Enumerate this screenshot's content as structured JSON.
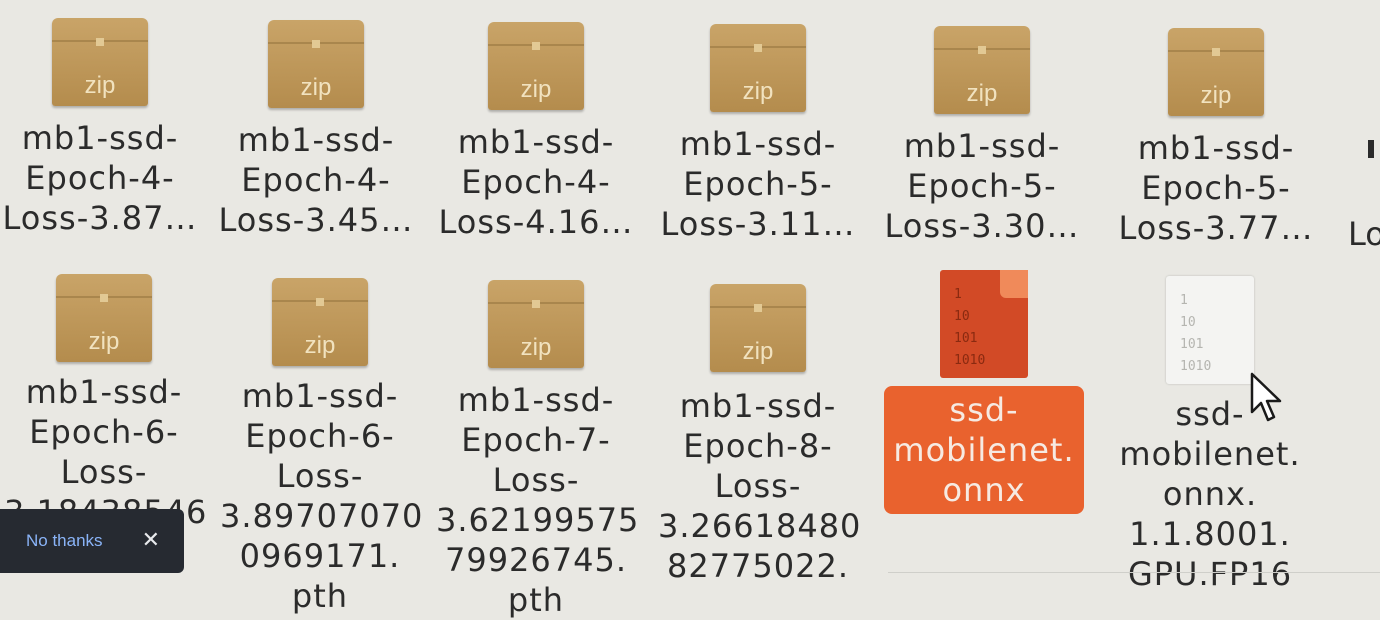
{
  "files": [
    {
      "type": "zip",
      "icon_label": "zip",
      "name_lines": [
        "mb1-ssd-",
        "Epoch-4-",
        "Loss-3.87…"
      ]
    },
    {
      "type": "zip",
      "icon_label": "zip",
      "name_lines": [
        "mb1-ssd-",
        "Epoch-4-",
        "Loss-3.45…"
      ]
    },
    {
      "type": "zip",
      "icon_label": "zip",
      "name_lines": [
        "mb1-ssd-",
        "Epoch-4-",
        "Loss-4.16…"
      ]
    },
    {
      "type": "zip",
      "icon_label": "zip",
      "name_lines": [
        "mb1-ssd-",
        "Epoch-5-",
        "Loss-3.11…"
      ]
    },
    {
      "type": "zip",
      "icon_label": "zip",
      "name_lines": [
        "mb1-ssd-",
        "Epoch-5-",
        "Loss-3.30…"
      ]
    },
    {
      "type": "zip",
      "icon_label": "zip",
      "name_lines": [
        "mb1-ssd-",
        "Epoch-5-",
        "Loss-3.77…"
      ]
    },
    {
      "type": "zip",
      "icon_label": "zip",
      "name_lines": [
        "mb1-ssd-",
        "Epoch-6-",
        "Loss-",
        "3.18438546"
      ]
    },
    {
      "type": "zip",
      "icon_label": "zip",
      "name_lines": [
        "mb1-ssd-",
        "Epoch-6-",
        "Loss-",
        "3.89707070",
        "0969171.",
        "pth"
      ]
    },
    {
      "type": "zip",
      "icon_label": "zip",
      "name_lines": [
        "mb1-ssd-",
        "Epoch-7-",
        "Loss-",
        "3.62199575",
        "79926745.",
        "pth"
      ]
    },
    {
      "type": "zip",
      "icon_label": "zip",
      "name_lines": [
        "mb1-ssd-",
        "Epoch-8-",
        "Loss-",
        "3.26618480",
        "82775022."
      ]
    },
    {
      "type": "binary",
      "selected": true,
      "digits": "1\n10\n101\n1010",
      "name_lines": [
        "ssd-",
        "mobilenet.",
        "onnx"
      ]
    },
    {
      "type": "binary",
      "selected": false,
      "digits": "1\n10\n101\n1010",
      "name_lines": [
        "ssd-",
        "mobilenet.",
        "onnx.",
        "1.1.8001.",
        "GPU.FP16"
      ]
    }
  ],
  "partial_label": "Lo",
  "toast": {
    "action_label": "No thanks",
    "close_glyph": "✕"
  },
  "colors": {
    "selection": "#e9622e",
    "zip": "#b48c4d",
    "binary_selected": "#d24a26",
    "toast_bg": "#262a31",
    "toast_link": "#8ab4f8"
  }
}
